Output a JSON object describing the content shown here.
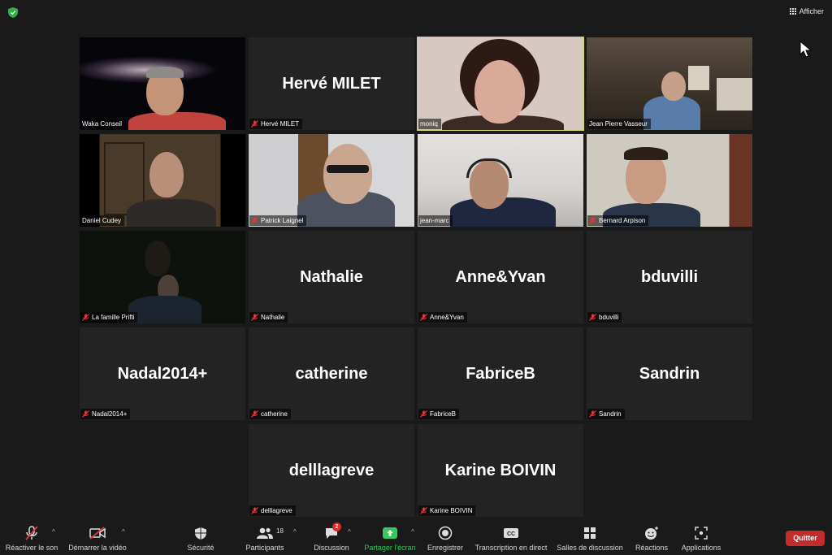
{
  "top": {
    "view_label": "Afficher"
  },
  "tiles": [
    {
      "name": "Waka Conseil"
    },
    {
      "name": "Hervé MILET",
      "big": "Hervé MILET"
    },
    {
      "name": "moniq"
    },
    {
      "name": "Jean Pierre Vasseur"
    },
    {
      "name": "Daniel Cudey"
    },
    {
      "name": "Patrick Laignel"
    },
    {
      "name": "jean-marc"
    },
    {
      "name": "Bernard Arpison"
    },
    {
      "name": "La famille Prifti"
    },
    {
      "name": "Nathalie",
      "big": "Nathalie"
    },
    {
      "name": "Anne&Yvan",
      "big": "Anne&Yvan"
    },
    {
      "name": "bduvilli",
      "big": "bduvilli"
    },
    {
      "name": "Nadal2014+",
      "big": "Nadal2014+"
    },
    {
      "name": "catherine",
      "big": "catherine"
    },
    {
      "name": "FabriceB",
      "big": "FabriceB"
    },
    {
      "name": "Sandrin",
      "big": "Sandrin"
    },
    {
      "name": "delllagreve",
      "big": "delllagreve"
    },
    {
      "name": "Karine BOIVIN",
      "big": "Karine BOIVIN"
    }
  ],
  "toolbar": {
    "unmute": "Réactiver le son",
    "start_video": "Démarrer la vidéo",
    "security": "Sécurité",
    "participants": "Participants",
    "participants_count": "18",
    "chat": "Discussion",
    "chat_badge": "2",
    "share": "Partager l'écran",
    "record": "Enregistrer",
    "transcription": "Transcription en direct",
    "breakout": "Salles de discussion",
    "reactions": "Réactions",
    "apps": "Applications",
    "quit": "Quitter",
    "cc": "CC"
  },
  "colors": {
    "active_speaker": "#c7d85a",
    "share_green": "#36c65a",
    "quit_red": "#c22c2c",
    "mute_red": "#e03a3a"
  }
}
